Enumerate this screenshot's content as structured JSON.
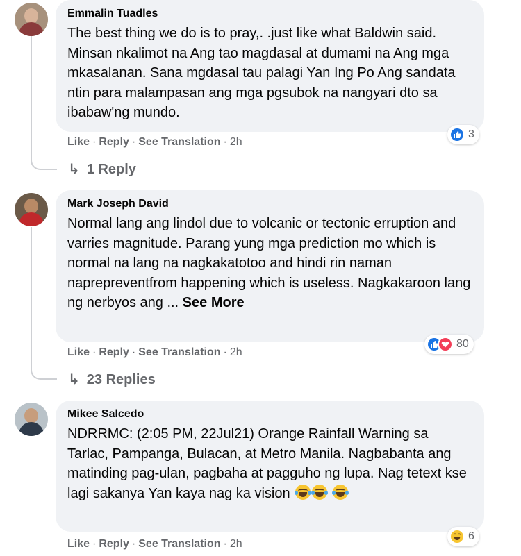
{
  "comments": [
    {
      "author": "Emmalin Tuadles",
      "text": "The best thing we do is to pray,. .just like what Baldwin said. Minsan nkalimot na Ang tao magdasal at dumami na Ang mga mkasalanan. Sana mgdasal tau palagi Yan Ing Po Ang sandata ntin para malampasan ang mga pgsubok na nangyari dto sa ibabaw'ng mundo.",
      "see_more": "",
      "actions": {
        "like": "Like",
        "reply": "Reply",
        "translate": "See Translation",
        "time": "2h"
      },
      "reaction_count": "3",
      "reaction_types": [
        "like-icon"
      ],
      "replies_label": "1 Reply"
    },
    {
      "author": "Mark Joseph David",
      "text": "Normal lang ang lindol due to volcanic or tectonic erruption and varries magnitude. Parang yung mga prediction mo which is normal na lang na nagkakatotoo and hindi rin naman naprepreventfrom happening which is useless. Nagkakaroon lang ng nerbyos ang ... ",
      "see_more": "See More",
      "actions": {
        "like": "Like",
        "reply": "Reply",
        "translate": "See Translation",
        "time": "2h"
      },
      "reaction_count": "80",
      "reaction_types": [
        "like-icon",
        "love-icon"
      ],
      "replies_label": "23 Replies"
    },
    {
      "author": "Mikee Salcedo",
      "text": "NDRRMC: (2:05 PM, 22Jul21) Orange Rainfall Warning sa Tarlac, Pampanga, Bulacan, at Metro Manila. Nagbabanta ang matinding pag-ulan, pagbaha at pagguho ng lupa. Nag tetext kse lagi sakanya Yan kaya nag ka vision ",
      "see_more": "",
      "actions": {
        "like": "Like",
        "reply": "Reply",
        "translate": "See Translation",
        "time": "2h"
      },
      "reaction_count": "6",
      "reaction_types": [
        "haha-icon"
      ],
      "replies_label": ""
    }
  ],
  "colors": {
    "bubble": "#f0f2f5",
    "meta_text": "#65676b",
    "like_blue": "#1b74e4",
    "love_red": "#f33e58",
    "haha_yellow": "#f7c531"
  }
}
